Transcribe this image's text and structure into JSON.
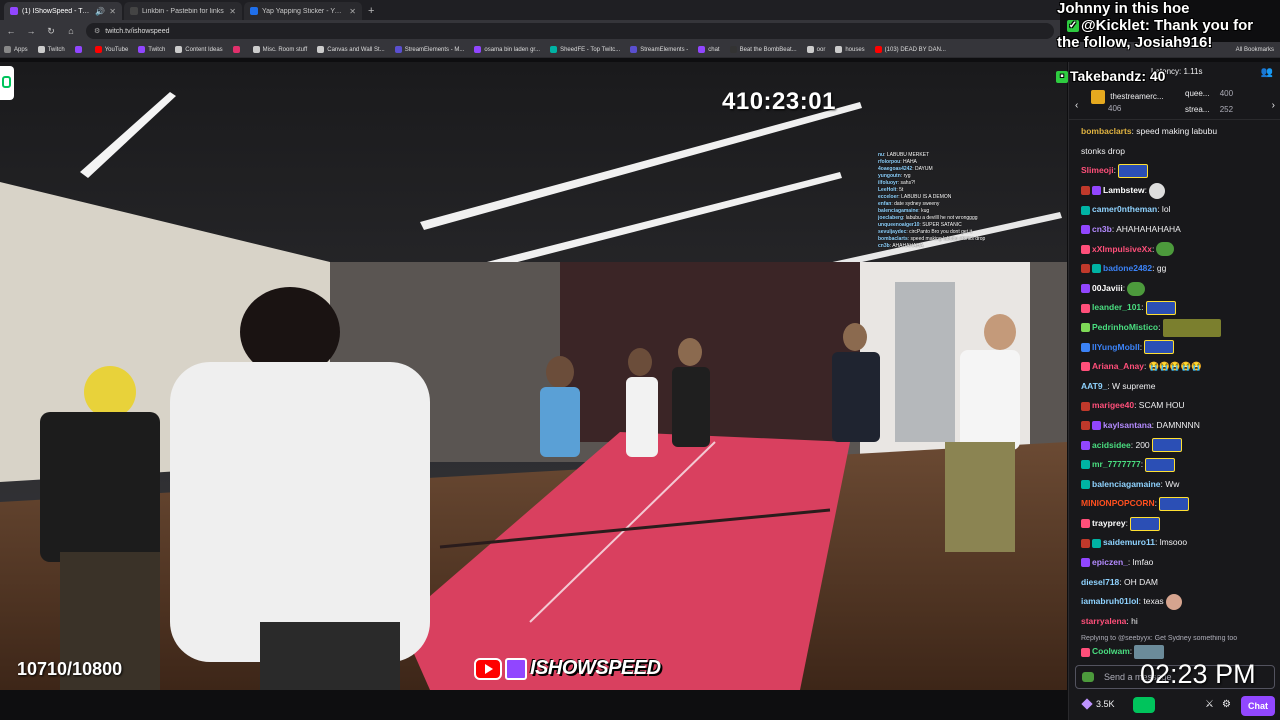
{
  "tabs": [
    {
      "title": "(1) IShowSpeed - Twitch",
      "color": "#9146ff",
      "active": true
    },
    {
      "title": "Linkbin - Pastebin for links",
      "color": "#444444",
      "active": false
    },
    {
      "title": "Yap Yapping Sticker - Yap Yapp",
      "color": "#1f6feb",
      "active": false
    }
  ],
  "address": {
    "url": "twitch.tv/ishowspeed"
  },
  "bookmarks": [
    {
      "label": "Apps",
      "color": "#888888"
    },
    {
      "label": "Twitch",
      "color": "#cccccc"
    },
    {
      "label": "",
      "color": "#9146ff"
    },
    {
      "label": "YouTube",
      "color": "#ff0000"
    },
    {
      "label": "Twitch",
      "color": "#9146ff"
    },
    {
      "label": "Content Ideas",
      "color": "#cccccc"
    },
    {
      "label": "",
      "color": "#e1306c"
    },
    {
      "label": "Misc. Room stuff",
      "color": "#cccccc"
    },
    {
      "label": "Canvas and Wall St...",
      "color": "#cccccc"
    },
    {
      "label": "StreamElements - M...",
      "color": "#5a4fcf"
    },
    {
      "label": "osama bin laden gr...",
      "color": "#9146ff"
    },
    {
      "label": "SheedFE - Top Twitc...",
      "color": "#00b3a4"
    },
    {
      "label": "StreamElements -",
      "color": "#5a4fcf"
    },
    {
      "label": "chat",
      "color": "#9146ff"
    },
    {
      "label": "Beat the BombBeat...",
      "color": "#333333"
    },
    {
      "label": "oor",
      "color": "#cccccc"
    },
    {
      "label": "houses",
      "color": "#cccccc"
    },
    {
      "label": "(103) DEAD BY DAN...",
      "color": "#ff0000"
    }
  ],
  "bookmarks_all": "All Bookmarks",
  "video": {
    "timer": "410:23:01",
    "counter": "10710/10800",
    "watermark": "ISHOWSPEED",
    "overlay_chat": [
      {
        "user": "nu",
        "text": "LABUBU MERKET"
      },
      {
        "user": "rfolorpou",
        "text": "HAHA"
      },
      {
        "user": "4oaegoas4242",
        "text": "DAYUM"
      },
      {
        "user": "yungoutn",
        "text": "ryg"
      },
      {
        "user": "ilfoluoyr",
        "text": "sahs?!"
      },
      {
        "user": "LeeHolt",
        "text": "5t"
      },
      {
        "user": "ecceloer",
        "text": "LABUBU IS A DEMON"
      },
      {
        "user": "enfan",
        "text": "date sydney sweeny"
      },
      {
        "user": "balenciagamaine",
        "text": "kug"
      },
      {
        "user": "joeclaberg",
        "text": "labubu a devilll he not wrongggg"
      },
      {
        "user": "unqueenoaiger10",
        "text": "SUPER SATANIC"
      },
      {
        "user": "sevuljaydec",
        "text": "circPanto Bro you dont get it"
      },
      {
        "user": "bombaclarts",
        "text": "speed making labubu stonks drop"
      },
      {
        "user": "cn3b",
        "text": "AHAHAHAHA"
      }
    ]
  },
  "follow_alert": {
    "line1": "Johnny in this hoe",
    "line2": "@Kicklet: Thank you for",
    "line3": "the follow, Josiah916!",
    "line4": "Takebandz: 40"
  },
  "chat": {
    "latency": "Latency: 1.11s",
    "gifts": [
      {
        "name": "thestreamerc...",
        "count": "406"
      },
      {
        "name": "quee...",
        "count": "400"
      },
      {
        "name": "strea...",
        "count": "252"
      }
    ],
    "messages": [
      {
        "user": "bombaclarts",
        "color": "#e0b341",
        "text": ": speed making labubu",
        "emote": "",
        "badges": []
      },
      {
        "user": "",
        "color": "#efeff1",
        "text": "stonks drop",
        "emote": "",
        "badges": []
      },
      {
        "user": "Slimeoji",
        "color": "#ff4f7a",
        "text": ":",
        "emote": "pepe",
        "badges": []
      },
      {
        "user": "Lambstew",
        "color": "#ffffff",
        "text": ":",
        "emote": "round",
        "badges": [
          "#c0392b",
          "#9146ff"
        ]
      },
      {
        "user": "camer0ntheman",
        "color": "#8fd3ff",
        "text": ": lol",
        "emote": "",
        "badges": [
          "#00b3a4"
        ]
      },
      {
        "user": "cn3b",
        "color": "#b48bff",
        "text": ": AHAHAHAHAHA",
        "emote": "",
        "badges": [
          "#9146ff"
        ]
      },
      {
        "user": "xXImpulsiveXx",
        "color": "#ff4f7a",
        "text": ":",
        "emote": "frog",
        "badges": [
          "#ff4f7a"
        ]
      },
      {
        "user": "badone2482",
        "color": "#3b82f6",
        "text": ": gg",
        "emote": "",
        "badges": [
          "#c0392b",
          "#00b3a4"
        ]
      },
      {
        "user": "00Javiii",
        "color": "#ffffff",
        "text": ":",
        "emote": "frog",
        "badges": [
          "#9146ff"
        ]
      },
      {
        "user": "leander_101",
        "color": "#4ade80",
        "text": ":",
        "emote": "pepe",
        "badges": [
          "#ff4f7a"
        ]
      },
      {
        "user": "PedrinhoMistico",
        "color": "#4ade80",
        "text": ":",
        "emote": "pic",
        "badges": [
          "#7ed957"
        ]
      },
      {
        "user": "IIYungMobII",
        "color": "#3b82f6",
        "text": ":",
        "emote": "pepe",
        "badges": [
          "#3b82f6"
        ]
      },
      {
        "user": "Ariana_Anay",
        "color": "#ff4f7a",
        "text": ": 😭😭😭😭😭",
        "emote": "",
        "badges": [
          "#ff4f7a"
        ]
      },
      {
        "user": "AAT9_",
        "color": "#8fd3ff",
        "text": ": W supreme",
        "emote": "",
        "badges": []
      },
      {
        "user": "marigee40",
        "color": "#ff4f7a",
        "text": ": SCAM HOU",
        "emote": "",
        "badges": [
          "#c0392b"
        ]
      },
      {
        "user": "kaylsantana",
        "color": "#b48bff",
        "text": ": DAMNNNN",
        "emote": "",
        "badges": [
          "#c0392b",
          "#9146ff"
        ]
      },
      {
        "user": "acidsidee",
        "color": "#4ade80",
        "text": ": 200",
        "emote": "pepe",
        "badges": [
          "#9146ff"
        ]
      },
      {
        "user": "mr_7777777",
        "color": "#4ade80",
        "text": ":",
        "emote": "pepe",
        "badges": [
          "#00b3a4"
        ]
      },
      {
        "user": "balenciagamaine",
        "color": "#8fd3ff",
        "text": ": Ww",
        "emote": "",
        "badges": [
          "#00b3a4"
        ]
      },
      {
        "user": "MINIONPOPCORN",
        "color": "#ff4f1f",
        "text": ":",
        "emote": "pepe",
        "badges": []
      },
      {
        "user": "trayprey",
        "color": "#ffffff",
        "text": ":",
        "emote": "pepe",
        "badges": [
          "#ff4f7a"
        ]
      },
      {
        "user": "saidemuro11",
        "color": "#8fd3ff",
        "text": ": lmsooo",
        "emote": "",
        "badges": [
          "#c0392b",
          "#00b3a4"
        ]
      },
      {
        "user": "epiczen_",
        "color": "#b48bff",
        "text": ": lmfao",
        "emote": "",
        "badges": [
          "#9146ff"
        ]
      },
      {
        "user": "diesel718",
        "color": "#8fd3ff",
        "text": ": OH DAM",
        "emote": "",
        "badges": []
      },
      {
        "user": "iamabruh01lol",
        "color": "#8fd3ff",
        "text": ": texas",
        "emote": "face",
        "badges": []
      },
      {
        "user": "starryalena",
        "color": "#ff4f7a",
        "text": ": hi",
        "emote": "",
        "badges": []
      }
    ],
    "reply_to": "Replying to @seebyyx: Get Sydney something too",
    "last_msg": {
      "user": "Coolwam",
      "color": "#4ade80",
      "text": ":"
    },
    "input_placeholder": "Send a message",
    "clock": "02:23 PM",
    "points": "3.5K",
    "chat_button": "Chat"
  }
}
